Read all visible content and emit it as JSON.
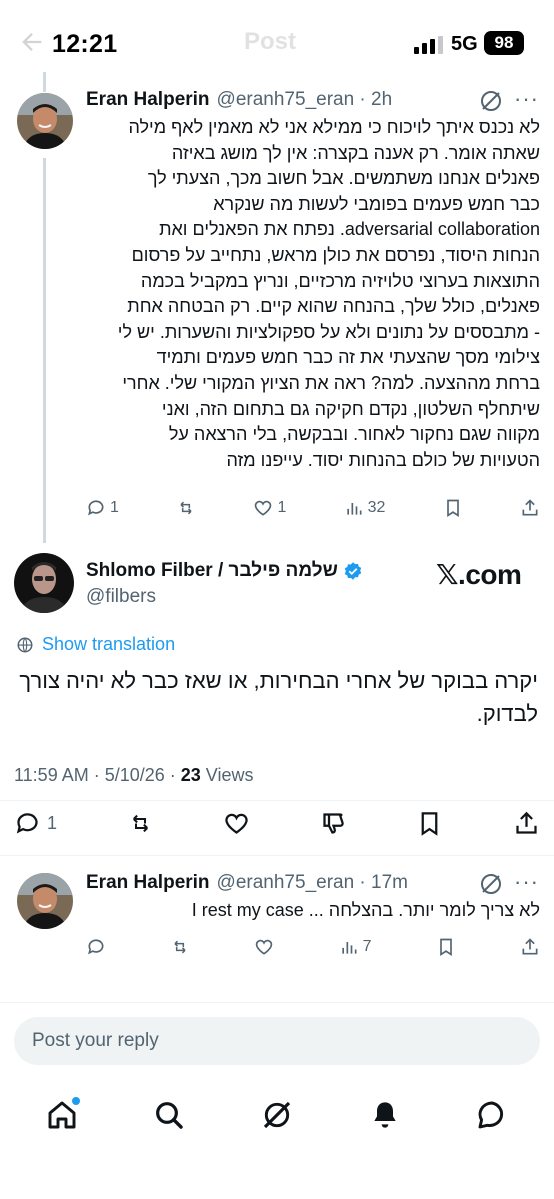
{
  "status_bar": {
    "time": "12:21",
    "network": "5G",
    "battery": "98"
  },
  "header": {
    "title": "Post"
  },
  "reply_above": {
    "author_name": "Eran Halperin",
    "handle_time": "@eranh75_eran · 2h",
    "lines": [
      "לא נכנס איתך לויכוח כי ממילא אני לא מאמין לאף מילה",
      "שאתה אומר. רק אענה בקצרה: אין לך מושג באיזה",
      "פאנלים אנחנו משתמשים. אבל חשוב מכך, הצעתי לך",
      "כבר חמש פעמים בפומבי לעשות מה שנקרא",
      "adversarial collaboration. נפתח את הפאנלים ואת",
      "הנחות היסוד, נפרסם את כולן מראש, נתחייב על פרסום",
      "התוצאות בערוצי טלויזיה מרכזיים, ונריץ במקביל בכמה",
      "פאנלים, כולל שלך, בהנחה שהוא קיים. רק הבטחה אחת",
      "- מתבססים על נתונים ולא על ספקולציות והשערות. יש לי",
      "צילומי מסך שהצעתי את זה כבר חמש פעמים ותמיד",
      "ברחת מההצעה. למה? ראה את הציוץ המקורי שלי. אחרי",
      "שיתחלף השלטון, נקדם חקיקה גם בתחום הזה, ואני",
      "מקווה שגם נחקור לאחור. ובבקשה, בלי הרצאה על",
      "הטעויות של כולם בהנחות יסוד. עייפנו מזה"
    ],
    "reply_count": "1",
    "like_count": "1",
    "view_count": "32"
  },
  "main_post": {
    "author_name": "Shlomo Filber / שלמה פילבר",
    "handle": "@filbers",
    "watermark": "𝕏.com",
    "show_translation": "Show translation",
    "text": "יקרה בבוקר של אחרי הבחירות, או שאז כבר לא יהיה צורך לבדוק.",
    "time_date": "11:59 AM · 5/10/26 · ",
    "views_count": "23",
    "views_label": " Views",
    "reply_count": "1"
  },
  "reply_below": {
    "author_name": "Eran Halperin",
    "handle_time": "@eranh75_eran · 17m",
    "text": "לא צריך לומר יותר. בהצלחה ... I rest my case",
    "view_count": "7"
  },
  "composer": {
    "placeholder": "Post your reply"
  },
  "nav": [
    "home-icon",
    "search-icon",
    "grok-icon",
    "notifications-icon",
    "messages-icon"
  ],
  "colors": {
    "accent": "#1d9bf0",
    "text_primary": "#0f1419",
    "text_secondary": "#536471"
  }
}
